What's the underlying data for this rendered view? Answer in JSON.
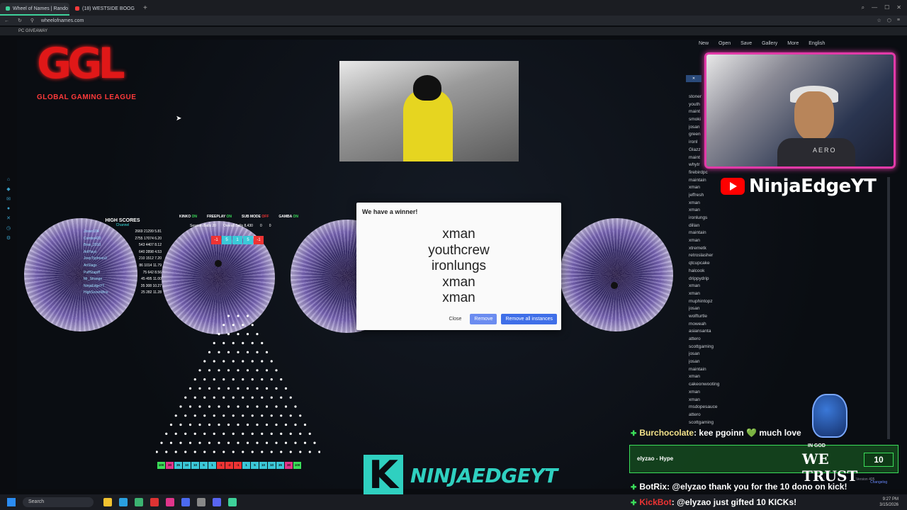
{
  "browser": {
    "tabs": [
      {
        "label": "Wheel of Names | Rando",
        "active": true,
        "icon_color": "#3ed19a"
      },
      {
        "label": "(18) WESTSIDE BOOG",
        "active": false,
        "icon_color": "#ff3b3b"
      }
    ],
    "url": "wheelofnames.com",
    "bookmark": "PC GIVEAWAY"
  },
  "wheel_toolbar": {
    "items": [
      "New",
      "Open",
      "Save",
      "Gallery",
      "More",
      "English"
    ]
  },
  "logo": {
    "mark": "GGL",
    "subtitle": "GLOBAL GAMING LEAGUE"
  },
  "webcam": {
    "brand": "AERO"
  },
  "channel": {
    "youtube_name": "NinjaEdgeYT"
  },
  "entries_panel": {
    "entries": [
      "stoner",
      "youth",
      "maint",
      "smoki",
      "josan",
      "green",
      "ironl",
      "Glazz",
      "maint",
      "whytr",
      "firebirdpc",
      "maintain",
      "xman",
      "jeffresh",
      "xman",
      "xman",
      "ironlungs",
      "dillan",
      "maintain",
      "xman",
      "xtremetk",
      "retroslasher",
      "qtcupcake",
      "halcook",
      "drippydrip",
      "xman",
      "xman",
      "muphintopz",
      "josan",
      "wolfturtle",
      "moweah",
      "asiansanta",
      "attero",
      "scottgaming",
      "josan",
      "josan",
      "maintain",
      "xman",
      "cakeonwooting",
      "xman",
      "xman",
      "msdopesauce",
      "attero",
      "scottgaming"
    ]
  },
  "scoreboard": {
    "title": "HIGH SCORES",
    "subtitle": "Channel",
    "rows": [
      {
        "name": "Josan104",
        "vals": "2669 21299 5.81"
      },
      {
        "name": "Combo420",
        "vals": "2755 17074 6.20"
      },
      {
        "name": "Brax_2010",
        "vals": "543 4407 8.12"
      },
      {
        "name": "AriPlayz",
        "vals": "640 2898 4.53"
      },
      {
        "name": "JoepTyphoon3",
        "vals": "210 1512 7.20"
      },
      {
        "name": "AriSlags",
        "vals": "86 1014 11.79"
      },
      {
        "name": "PuffStapiff",
        "vals": "75 642 8.56"
      },
      {
        "name": "Mr_Strange",
        "vals": "45 495 11.00"
      },
      {
        "name": "NinjaEdgeYT",
        "vals": "35 308 10.27"
      },
      {
        "name": "HighScoreWins",
        "vals": "25 282 11.28"
      }
    ]
  },
  "kick_status": {
    "kinko": "KINKO",
    "kinko_state": "ON",
    "freeplay": "FREEPLAY",
    "freeplay_state": "ON",
    "submode": "SUB MODE",
    "submode_state": "OFF",
    "gamba": "GAMBA",
    "gamba_state": "ON",
    "session_balls_label": "Session Balls",
    "session_balls": "20",
    "overall_balls_label": "Overall Balls",
    "overall_balls": "8,430",
    "extra_a": "0",
    "extra_b": "0",
    "counter": [
      "-1",
      "5",
      "1",
      "5",
      "-1"
    ]
  },
  "plinko_slots": [
    "100",
    "30",
    "35",
    "10",
    "10",
    "5",
    "1",
    "-1",
    "-2",
    "-1",
    "1",
    "5",
    "10",
    "10",
    "35",
    "30",
    "100"
  ],
  "winner_dialog": {
    "title": "We have a winner!",
    "winners": [
      "xman",
      "youthcrew",
      "ironlungs",
      "xman",
      "xman"
    ],
    "close_label": "Close",
    "remove_label": "Remove",
    "remove_all_label": "Remove all instances"
  },
  "chat": {
    "line1_user": "Burchocolate",
    "line1_msg": ": kee pgoinn 💚 much love",
    "donation_user": "elyzao",
    "donation_msg": "- Hype",
    "donation_amount": "10",
    "line2_user": "BotRix",
    "line2_msg": ": @elyzao thank you for the 10 dono on kick!",
    "line3_user": "KickBot",
    "line3_msg": ": @elyzao just gifted 10 KICKs!"
  },
  "badge": {
    "line1": "IN GOD",
    "line2": "WE TRUST"
  },
  "kick_brand": {
    "letter": "K",
    "text": "NINJAEDGEYT"
  },
  "footer": {
    "version": "Version 405",
    "changelog": "Changelog"
  },
  "taskbar": {
    "search_placeholder": "Search",
    "time": "9:27 PM",
    "date": "3/15/2026"
  }
}
